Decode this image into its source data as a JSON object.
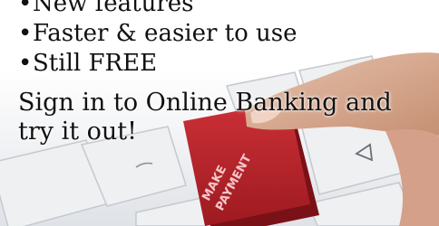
{
  "features": [
    {
      "bullet": "•",
      "text": "New features"
    },
    {
      "bullet": "•",
      "text": "Faster & easier to use"
    },
    {
      "bullet": "•",
      "text": "Still FREE"
    }
  ],
  "cta": {
    "line1": "Sign in to Online Banking and",
    "line2": "try it out!"
  },
  "key": {
    "line1": "MAKE",
    "line2": "PAYMENT"
  },
  "colors": {
    "key_red": "#b3262c",
    "key_shadow": "#7a1116",
    "keycap": "#eef0f2"
  }
}
